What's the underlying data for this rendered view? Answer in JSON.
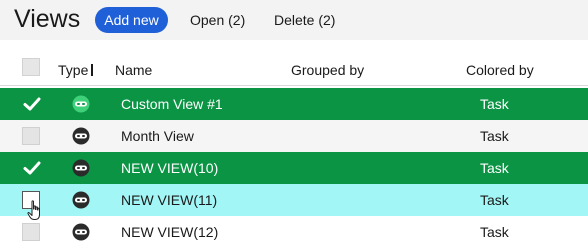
{
  "toolbar": {
    "title": "Views",
    "add_new_label": "Add new",
    "open_label": "Open (2)",
    "delete_label": "Delete (2)"
  },
  "table": {
    "columns": [
      "Type",
      "Name",
      "Grouped by",
      "Colored by"
    ],
    "rows": [
      {
        "name": "Custom View #1",
        "grouped_by": "",
        "colored_by": "Task",
        "selected": true,
        "hovered": false
      },
      {
        "name": "Month View",
        "grouped_by": "",
        "colored_by": "Task",
        "selected": false,
        "hovered": false
      },
      {
        "name": "NEW VIEW(10)",
        "grouped_by": "",
        "colored_by": "Task",
        "selected": true,
        "hovered": false
      },
      {
        "name": "NEW VIEW(11)",
        "grouped_by": "",
        "colored_by": "Task",
        "selected": false,
        "hovered": true
      },
      {
        "name": "NEW VIEW(12)",
        "grouped_by": "",
        "colored_by": "Task",
        "selected": false,
        "hovered": false
      }
    ]
  },
  "colors": {
    "accent_blue": "#1f5fd8",
    "selected_row": "#0b9444",
    "hover_row": "#a3f6f6",
    "icon_selected": "#3fd07a",
    "icon_default": "#2b2b2b"
  },
  "icons": {
    "type": "mask-icon",
    "check": "checkmark-icon",
    "cursor": "hand-pointer-icon"
  }
}
